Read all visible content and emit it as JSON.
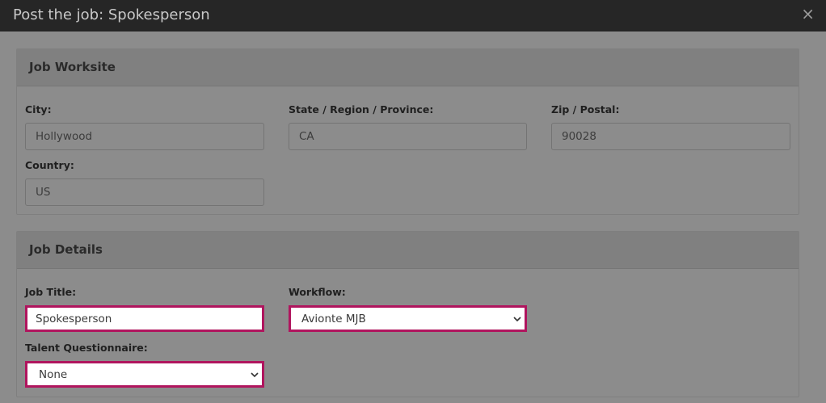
{
  "modal": {
    "title": "Post the job: Spokesperson",
    "close_symbol": "×"
  },
  "worksite": {
    "heading": "Job Worksite",
    "city_label": "City:",
    "city_value": "Hollywood",
    "state_label": "State / Region / Province:",
    "state_value": "CA",
    "zip_label": "Zip / Postal:",
    "zip_value": "90028",
    "country_label": "Country:",
    "country_value": "US"
  },
  "details": {
    "heading": "Job Details",
    "job_title_label": "Job Title:",
    "job_title_value": "Spokesperson",
    "workflow_label": "Workflow:",
    "workflow_value": "Avionte MJB",
    "questionnaire_label": "Talent Questionnaire:",
    "questionnaire_value": "None"
  },
  "colors": {
    "overlay": "#8c8c8c",
    "header": "#262626",
    "highlight": "#b0155e"
  }
}
